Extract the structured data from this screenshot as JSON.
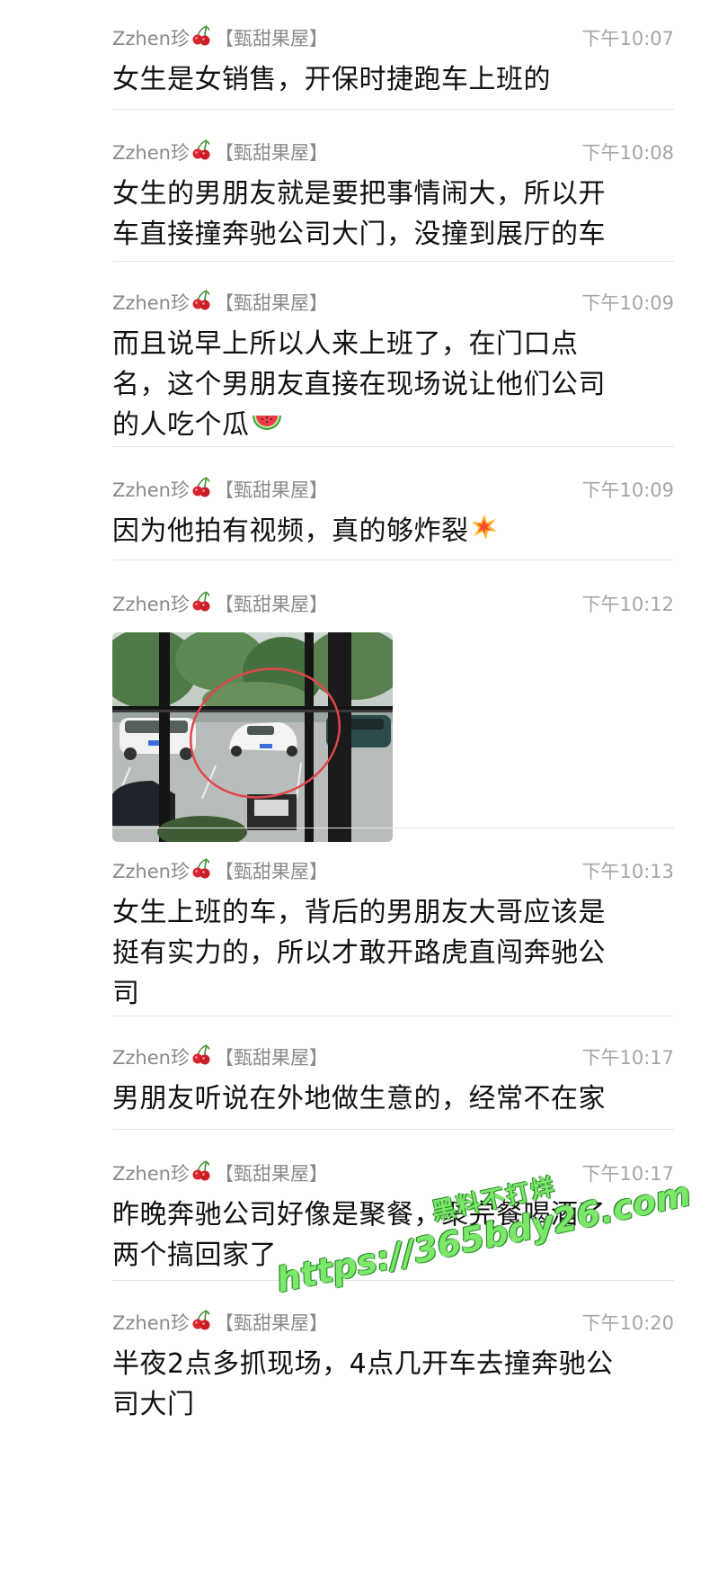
{
  "colors": {
    "sender": "#8a8a8a",
    "time": "#a5a5a5",
    "text": "#111111",
    "divider": "#e6e6e6",
    "watermark": "#7be86a",
    "circle": "#e0464a"
  },
  "messages": [
    {
      "sender": "Zzhen珍",
      "group": "【甄甜果屋】",
      "time": "下午10:07",
      "lines": [
        "女生是女销售，开保时捷跑车上班的"
      ]
    },
    {
      "sender": "Zzhen珍",
      "group": "【甄甜果屋】",
      "time": "下午10:08",
      "lines": [
        "女生的男朋友就是要把事情闹大，所以开",
        "车直接撞奔驰公司大门，没撞到展厅的车"
      ]
    },
    {
      "sender": "Zzhen珍",
      "group": "【甄甜果屋】",
      "time": "下午10:09",
      "lines": [
        "而且说早上所以人来上班了，在门口点",
        "名，这个男朋友直接在现场说让他们公司",
        "的人吃个瓜"
      ],
      "trailing_emoji": "watermelon-icon"
    },
    {
      "sender": "Zzhen珍",
      "group": "【甄甜果屋】",
      "time": "下午10:09",
      "lines": [
        "因为他拍有视频，真的够炸裂"
      ],
      "trailing_emoji": "collision-icon"
    },
    {
      "sender": "Zzhen珍",
      "group": "【甄甜果屋】",
      "time": "下午10:12",
      "image": "parking-lot-photo"
    },
    {
      "sender": "Zzhen珍",
      "group": "【甄甜果屋】",
      "time": "下午10:13",
      "lines": [
        "女生上班的车，背后的男朋友大哥应该是",
        "挺有实力的，所以才敢开路虎直闯奔驰公",
        "司"
      ]
    },
    {
      "sender": "Zzhen珍",
      "group": "【甄甜果屋】",
      "time": "下午10:17",
      "lines": [
        "男朋友听说在外地做生意的，经常不在家"
      ]
    },
    {
      "sender": "Zzhen珍",
      "group": "【甄甜果屋】",
      "time": "下午10:17",
      "lines": [
        "昨晚奔驰公司好像是聚餐，聚完餐喝酒了",
        "两个搞回家了"
      ]
    },
    {
      "sender": "Zzhen珍",
      "group": "【甄甜果屋】",
      "time": "下午10:20",
      "lines": [
        "半夜2点多抓现场，4点几开车去撞奔驰公",
        "司大门"
      ]
    }
  ],
  "watermark": {
    "line1": "黑料不打烊",
    "line2": "https://365bdy26.com"
  }
}
